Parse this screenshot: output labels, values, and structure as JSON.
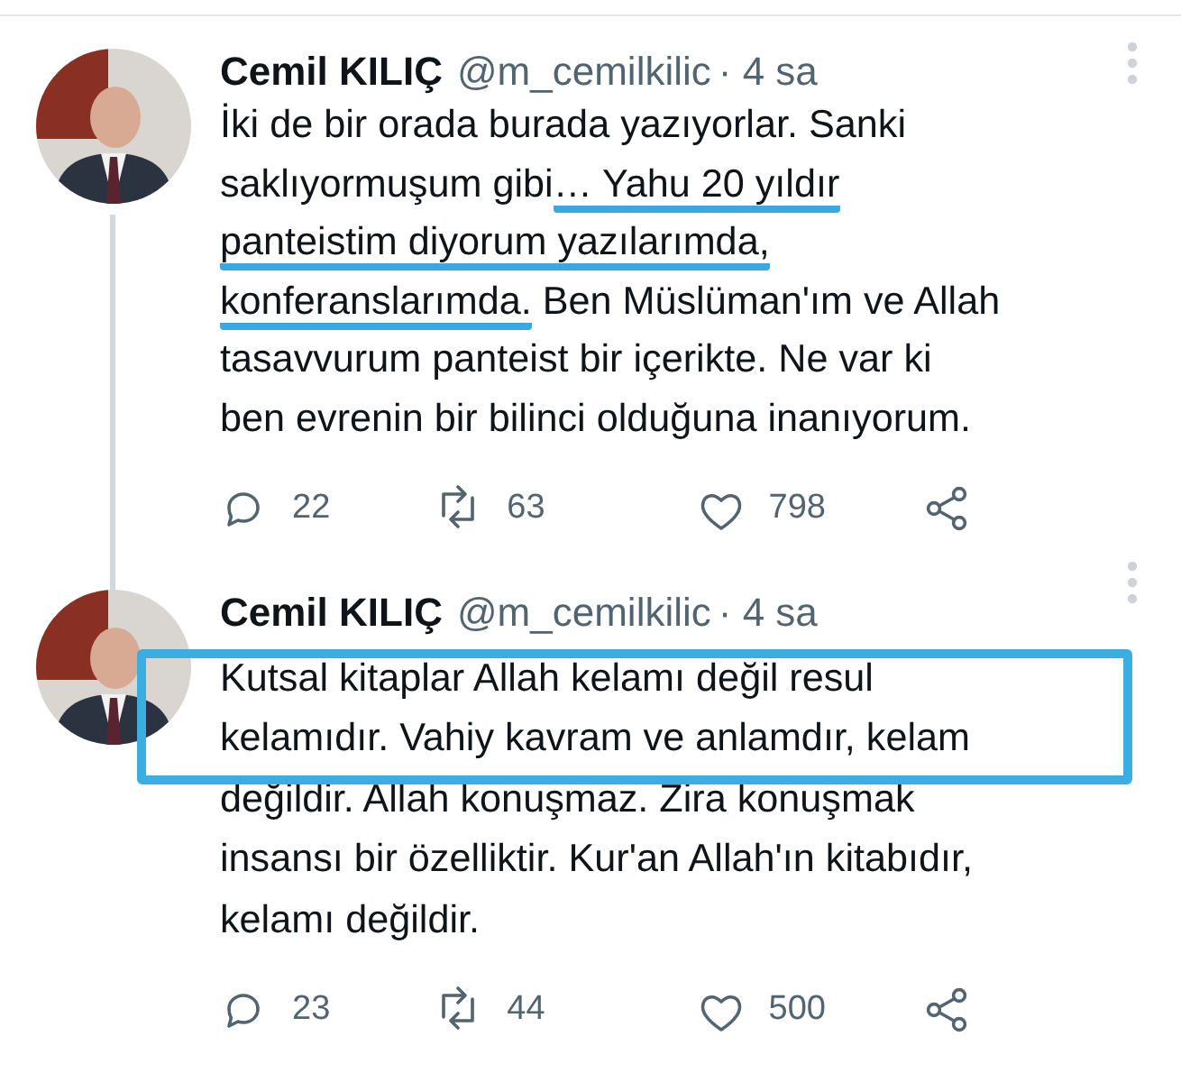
{
  "tweets": [
    {
      "name": "Cemil KILIÇ",
      "handle": "@m_cemilkilic",
      "time": "· 4 sa",
      "lines": [
        {
          "segments": [
            {
              "text": "İki de bir orada burada yazıyorlar. Sanki",
              "underlined": false
            }
          ]
        },
        {
          "segments": [
            {
              "text": "saklıyormuşum gibi",
              "underlined": false
            },
            {
              "text": "… Yahu 20 yıldır",
              "underlined": true
            }
          ]
        },
        {
          "segments": [
            {
              "text": "panteistim diyorum yazılarımda,",
              "underlined": true
            }
          ]
        },
        {
          "segments": [
            {
              "text": "konferanslarımda.",
              "underlined": true
            },
            {
              "text": " Ben Müslüman'ım ve Allah",
              "underlined": false
            }
          ]
        },
        {
          "segments": [
            {
              "text": "tasavvurum panteist bir içerikte. Ne var ki",
              "underlined": false
            }
          ]
        },
        {
          "segments": [
            {
              "text": "ben evrenin bir bilinci olduğuna inanıyorum.",
              "underlined": false
            }
          ]
        }
      ],
      "actions": [
        {
          "kind": "reply",
          "count": "22"
        },
        {
          "kind": "retweet",
          "count": "63"
        },
        {
          "kind": "like",
          "count": "798"
        },
        {
          "kind": "share"
        }
      ]
    },
    {
      "name": "Cemil KILIÇ",
      "handle": "@m_cemilkilic",
      "time": "· 4 sa",
      "lines": [
        {
          "boxed": true,
          "segments": [
            {
              "text": "Kutsal kitaplar Allah kelamı değil resul",
              "underlined": false
            }
          ]
        },
        {
          "boxed": true,
          "segments": [
            {
              "text": "kelamıdır. Vahiy kavram ve anlamdır, kelam",
              "underlined": false
            }
          ]
        },
        {
          "boxed": false,
          "segments": [
            {
              "text": "değildir. Allah konuşmaz. Zira konuşmak",
              "underlined": false
            }
          ]
        },
        {
          "boxed": false,
          "segments": [
            {
              "text": "insansı bir özelliktir. Kur'an Allah'ın kitabıdır,",
              "underlined": false
            }
          ]
        },
        {
          "boxed": false,
          "segments": [
            {
              "text": "kelamı değildir.",
              "underlined": false
            }
          ]
        }
      ],
      "actions": [
        {
          "kind": "reply",
          "count": "23"
        },
        {
          "kind": "retweet",
          "count": "44"
        },
        {
          "kind": "like",
          "count": "500"
        },
        {
          "kind": "share"
        }
      ]
    }
  ]
}
